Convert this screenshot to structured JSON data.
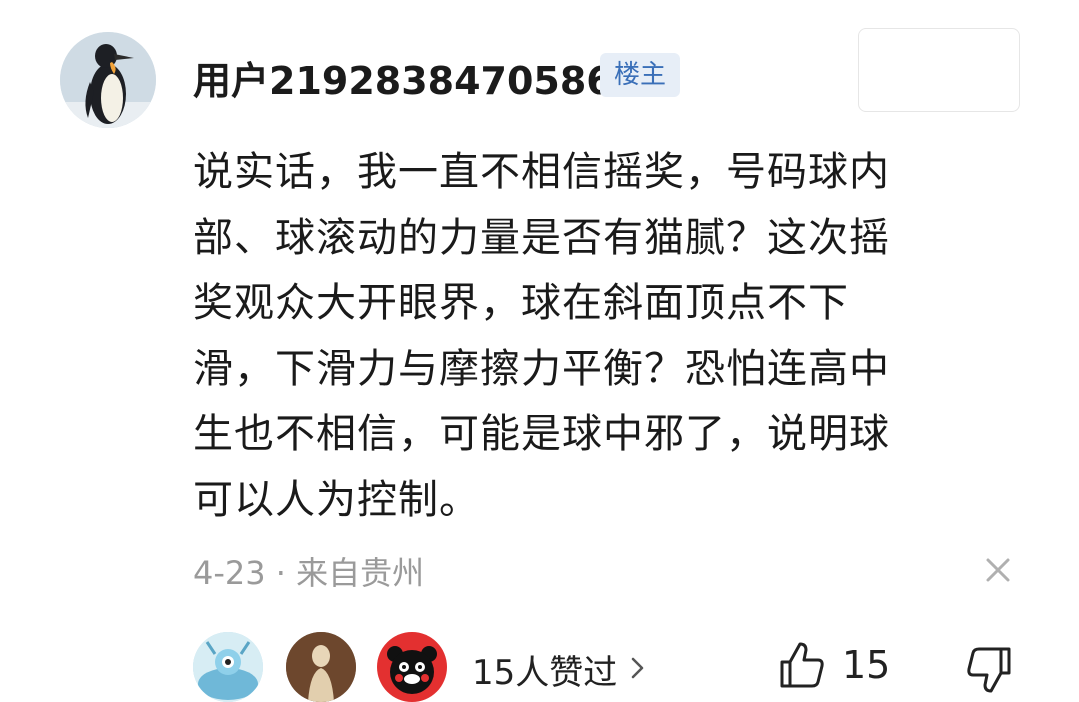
{
  "post": {
    "username": "用户2192838470586",
    "badge": "楼主",
    "comment_lines": [
      "说实话，我一直不相信摇奖，号码球内",
      "部、球滚动的力量是否有猫腻？这次摇",
      "奖观众大开眼界，球在斜面顶点不下",
      "滑，下滑力与摩擦力平衡？恐怕连高中",
      "生也不相信，可能是球中邪了，说明球",
      "可以人为控制。"
    ],
    "meta": "4-23 · 来自贵州"
  },
  "reactions": {
    "liked_by_text": "15人赞过",
    "like_count": "15"
  },
  "icons": [
    "avatar-penguin",
    "close-icon",
    "chevron-right-icon",
    "thumbs-up-icon",
    "thumbs-down-icon"
  ],
  "colors": {
    "badge_bg": "#e7eef7",
    "badge_text": "#3a6fb8",
    "meta": "#9a9a9a"
  }
}
